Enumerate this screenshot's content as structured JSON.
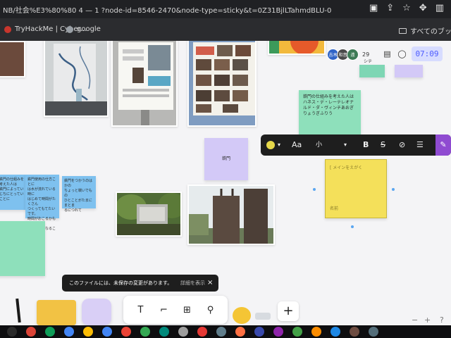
{
  "browser": {
    "url": "NB/社会%E3%80%80 4 — 1 ?node-id=8546-2470&node-type=sticky&t=0Z31BjlLTahmdBLU-0",
    "icons": [
      "clipboard-icon",
      "share-icon",
      "star-icon",
      "extensions-icon",
      "sidebar-icon"
    ],
    "bookmarks": [
      {
        "label": "TryHackMe | Cyber...",
        "icon": "tryhackme-icon",
        "color": "#c8362d"
      },
      {
        "label": "google",
        "icon": "globe-icon",
        "color": "#9aa0a6"
      }
    ],
    "all_bookmarks": "すべてのブック"
  },
  "header": {
    "avatars": [
      {
        "label": "吉木",
        "color": "#2f64c7"
      },
      {
        "label": "和音",
        "color": "#4a4a4a"
      },
      {
        "label": "遠",
        "color": "#3d7a55"
      }
    ],
    "avatar_count": "29",
    "timer": "07:09",
    "icons": [
      "layout-icon",
      "comment-icon"
    ]
  },
  "toolbar": {
    "font_label": "Aa",
    "size_label": "小",
    "bold": "B",
    "strike": "S",
    "link": "⊘",
    "list": "☰",
    "color": "#e6d84a",
    "accent": "#8f4bd1"
  },
  "stickies": {
    "green_main": "鉄門の仕組みを考えた人は\nハネス・デ・レーテレオナ\nルド・ダ・ヴィンチあおぎ\nりょうぎふりう",
    "purple_small": "鉄門",
    "yellow_right_top": "[ メインをえがく",
    "yellow_right_bottom": "名前",
    "top_tag": "シテ",
    "blue_1": "鉄門の仕組みを考えた人は\n鉄門によってい\nじちにとってい\nことに",
    "blue_2": "鉄門使用の仕方ことに\nは水が流れている時に\nはじめて時間がたくさん\nつくってもてたいです。\n時間がおこるかもしれな\nいの小さくなることに\nことに",
    "blue_3": "鉄門をつかうのはかの\nちょっと戦いでもの\nひとことがたまにまとま\nるにつれて"
  },
  "toast": {
    "message": "このファイルには、未保存の変更があります。",
    "link": "詳細を表示",
    "close": "×"
  },
  "dock": {
    "tools": [
      "text-tool-icon",
      "section-tool-icon",
      "table-tool-icon",
      "stamp-tool-icon"
    ],
    "plus": "+"
  },
  "zoom": {
    "minus": "−",
    "plus": "+",
    "help": "?"
  },
  "taskbar": {
    "icons": [
      "chrome-icon",
      "sheets-icon",
      "word-icon",
      "files-icon",
      "calendar-icon",
      "mail-icon",
      "meet-icon",
      "play-icon",
      "music-icon",
      "store-icon",
      "settings-icon",
      "gallery-icon",
      "app-icon",
      "app-icon-2",
      "app-icon-3",
      "app-icon-4",
      "app-icon-5",
      "app-icon-6",
      "app-icon-7",
      "app-icon-8"
    ]
  }
}
